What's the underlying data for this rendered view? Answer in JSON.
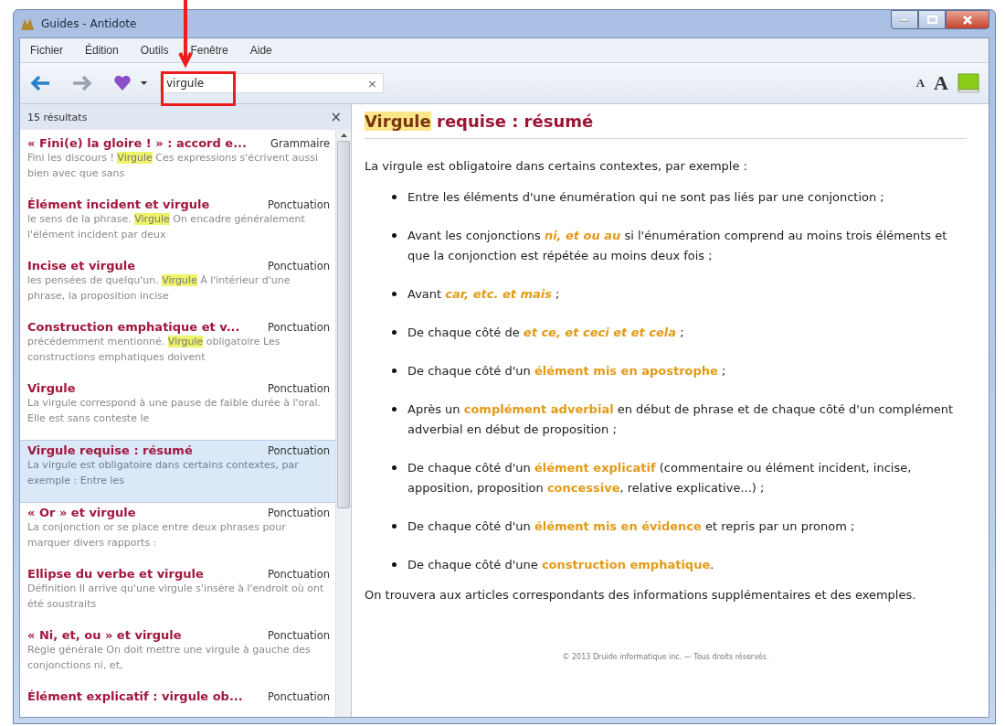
{
  "window": {
    "title": "Guides - Antidote"
  },
  "menu": [
    "Fichier",
    "Édition",
    "Outils",
    "Fenêtre",
    "Aide"
  ],
  "toolbar": {
    "search": {
      "value": "virgule",
      "clear": "×"
    },
    "font_small": "A",
    "font_large": "A"
  },
  "results": {
    "count": "15 résultats",
    "close": "×",
    "items": [
      {
        "title": "« Fini(e) la gloire ! » : accord e...",
        "category": "Grammaire",
        "snippet": "Fini les discours ! **Virgule** Ces expressions s'écrivent aussi bien avec que sans",
        "selected": false
      },
      {
        "title": "Élément incident et virgule",
        "category": "Ponctuation",
        "snippet": "le sens de la phrase. **Virgule** On encadre généralement l'élément incident par deux",
        "selected": false
      },
      {
        "title": "Incise et virgule",
        "category": "Ponctuation",
        "snippet": "les pensées de quelqu'un. **Virgule** À l'intérieur d'une phrase, la proposition incise",
        "selected": false
      },
      {
        "title": "Construction emphatique et v...",
        "category": "Ponctuation",
        "snippet": "précédemment mentionné. **Virgule** obligatoire Les constructions emphatiques doivent",
        "selected": false
      },
      {
        "title": "Virgule",
        "category": "Ponctuation",
        "snippet": "La virgule correspond à une pause de faible durée à l'oral. Elle est sans conteste le",
        "selected": false
      },
      {
        "title": "Virgule requise : résumé",
        "category": "Ponctuation",
        "snippet": "La virgule est obligatoire dans certains contextes, par exemple : Entre les",
        "selected": true
      },
      {
        "title": "« Or » et virgule",
        "category": "Ponctuation",
        "snippet": "La conjonction or se place entre deux phrases pour marquer divers rapports :",
        "selected": false
      },
      {
        "title": "Ellipse du verbe et virgule",
        "category": "Ponctuation",
        "snippet": "Définition Il arrive qu'une virgule s'insère à l'endroit où ont été soustraits",
        "selected": false
      },
      {
        "title": "« Ni, et, ou » et virgule",
        "category": "Ponctuation",
        "snippet": "Règle générale On doit mettre une virgule à gauche des conjonctions ni, et,",
        "selected": false
      },
      {
        "title": "Élément explicatif : virgule ob...",
        "category": "Ponctuation",
        "selected": false
      }
    ]
  },
  "article": {
    "title": "**Virgule** requise : résumé",
    "intro": "La virgule est obligatoire dans certains contextes, par exemple :",
    "bullets": [
      "Entre les éléments d'une énumération qui ne sont pas liés par une conjonction ;",
      "Avant les conjonctions *ni, et ou au* si l'énumération comprend au moins trois éléments et que la conjonction est répétée au moins deux fois ;",
      "Avant *car, etc. et mais* ;",
      "De chaque côté de *et ce, et ceci et et cela* ;",
      "De chaque côté d'un **élément mis en apostrophe** ;",
      "Après un **complément adverbial** en début de phrase et de chaque côté d'un complément adverbial en début de proposition ;",
      "De chaque côté d'un **élément explicatif** (commentaire ou élément incident, incise, apposition, proposition **concessive**, relative explicative...) ;",
      "De chaque côté d'un **élément mis en évidence** et repris par un pronom ;",
      "De chaque côté d'une **construction emphatique**."
    ],
    "outro": "On trouvera aux articles correspondants des informations supplémentaires et des exemples.",
    "footer": "© 2013 Druide informatique inc. — Tous droits réservés."
  }
}
